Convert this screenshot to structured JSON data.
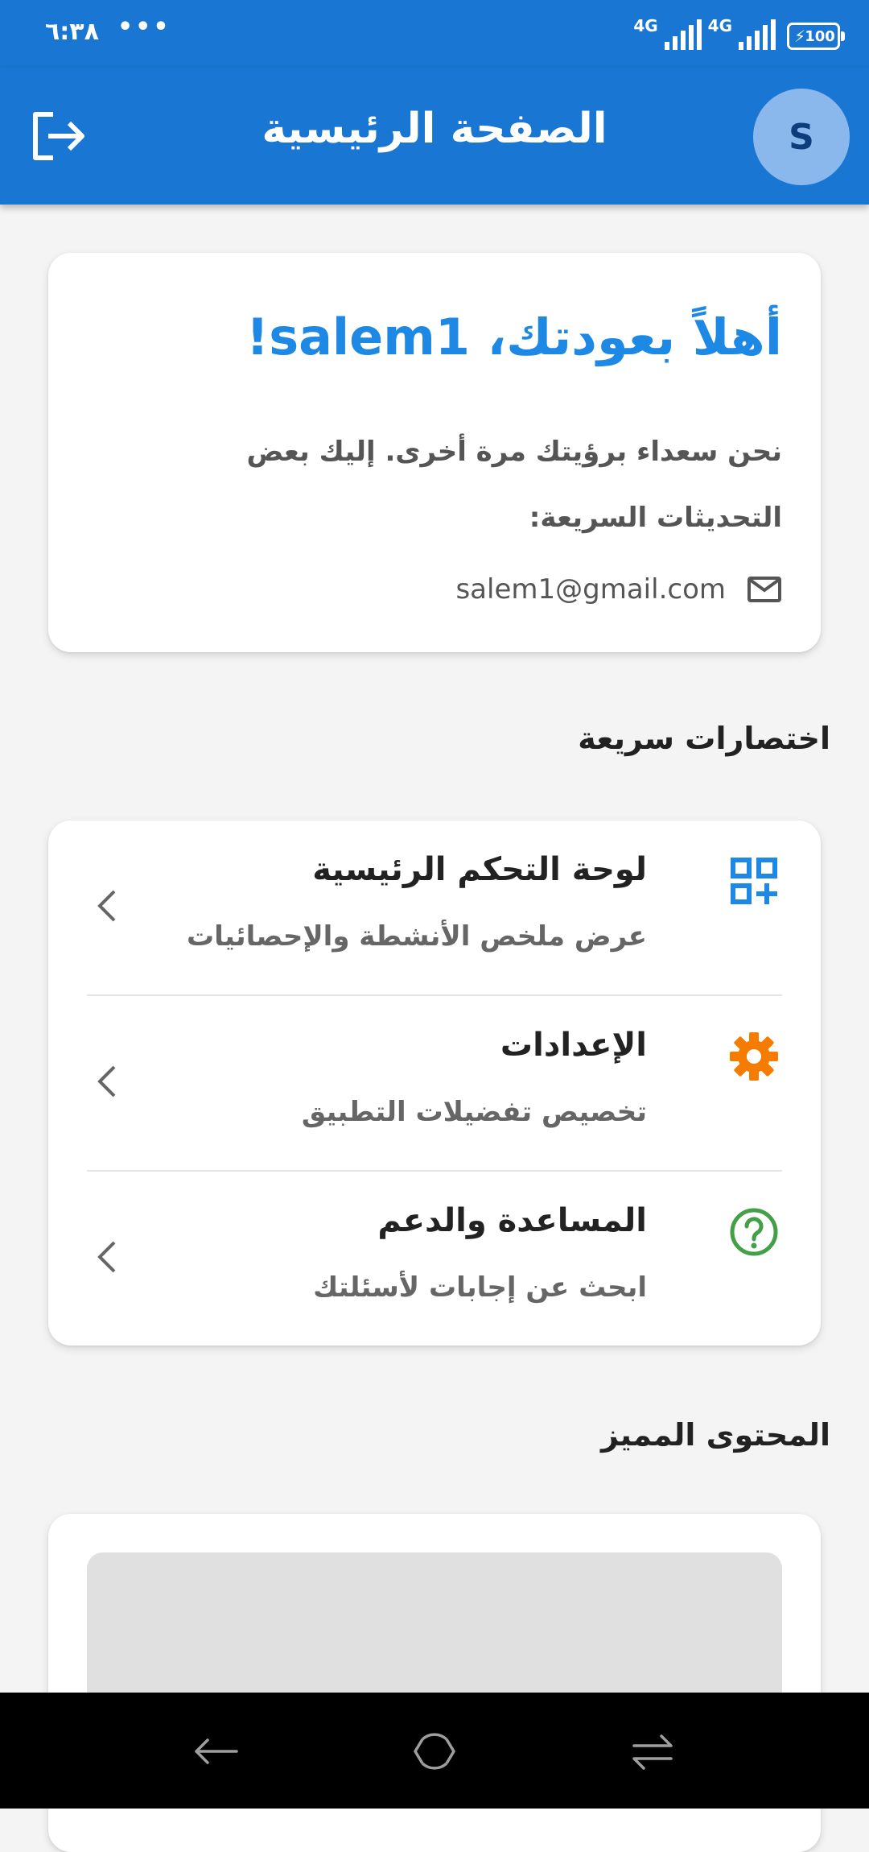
{
  "status_bar": {
    "time": "٦:٣٨",
    "dots": "•••",
    "network_1": "4G",
    "network_2": "4G",
    "battery": "100"
  },
  "app_bar": {
    "title": "الصفحة الرئيسية",
    "avatar_initial": "S"
  },
  "welcome": {
    "title": "أهلاً بعودتك، salem1!",
    "message": "نحن سعداء برؤيتك مرة أخرى. إليك بعض التحديثات السريعة:",
    "email": "salem1@gmail.com"
  },
  "quick_shortcuts": {
    "heading": "اختصارات سريعة",
    "items": [
      {
        "title": "لوحة التحكم الرئيسية",
        "subtitle": "عرض ملخص الأنشطة والإحصائيات",
        "icon": "dashboard-icon",
        "color": "#1e88e5"
      },
      {
        "title": "الإعدادات",
        "subtitle": "تخصيص تفضيلات التطبيق",
        "icon": "settings-gear-icon",
        "color": "#f57c00"
      },
      {
        "title": "المساعدة والدعم",
        "subtitle": "ابحث عن إجابات لأسئلتك",
        "icon": "help-icon",
        "color": "#43a047"
      }
    ]
  },
  "featured": {
    "heading": "المحتوى المميز"
  },
  "colors": {
    "primary": "#1976d2",
    "accent": "#1e88e5",
    "background": "#f4f4f4"
  }
}
